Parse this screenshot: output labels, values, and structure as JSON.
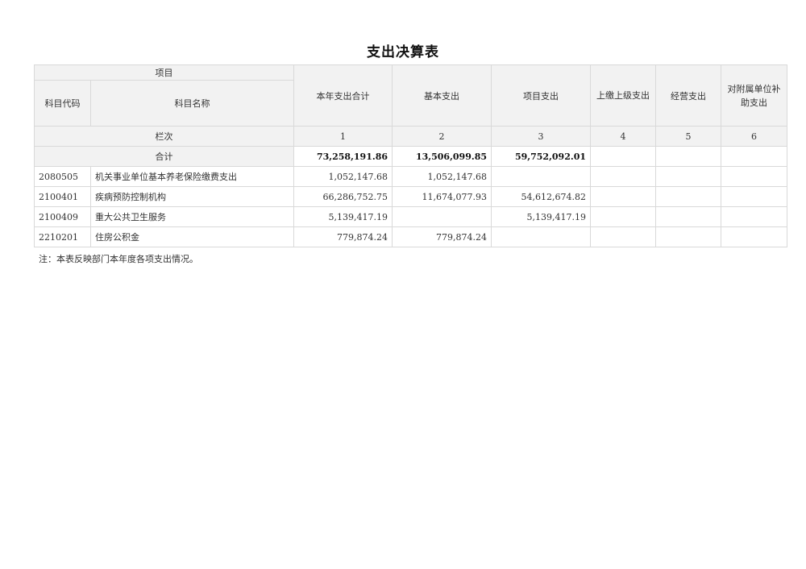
{
  "title": "支出决算表",
  "header": {
    "item_group": "项目",
    "subject_code": "科目代码",
    "subject_name": "科目名称",
    "columns": [
      "本年支出合计",
      "基本支出",
      "项目支出",
      "上缴上级支出",
      "经营支出",
      "对附属单位补助支出"
    ]
  },
  "lanci": {
    "label": "栏次",
    "numbers": [
      "1",
      "2",
      "3",
      "4",
      "5",
      "6"
    ]
  },
  "total": {
    "label": "合计",
    "values": [
      "73,258,191.86",
      "13,506,099.85",
      "59,752,092.01",
      "",
      "",
      ""
    ]
  },
  "rows": [
    {
      "code": "2080505",
      "name": "机关事业单位基本养老保险缴费支出",
      "values": [
        "1,052,147.68",
        "1,052,147.68",
        "",
        "",
        "",
        ""
      ]
    },
    {
      "code": "2100401",
      "name": "疾病预防控制机构",
      "values": [
        "66,286,752.75",
        "11,674,077.93",
        "54,612,674.82",
        "",
        "",
        ""
      ]
    },
    {
      "code": "2100409",
      "name": "重大公共卫生服务",
      "values": [
        "5,139,417.19",
        "",
        "5,139,417.19",
        "",
        "",
        ""
      ]
    },
    {
      "code": "2210201",
      "name": "住房公积金",
      "values": [
        "779,874.24",
        "779,874.24",
        "",
        "",
        "",
        ""
      ]
    }
  ],
  "note": "注：本表反映部门本年度各项支出情况。"
}
